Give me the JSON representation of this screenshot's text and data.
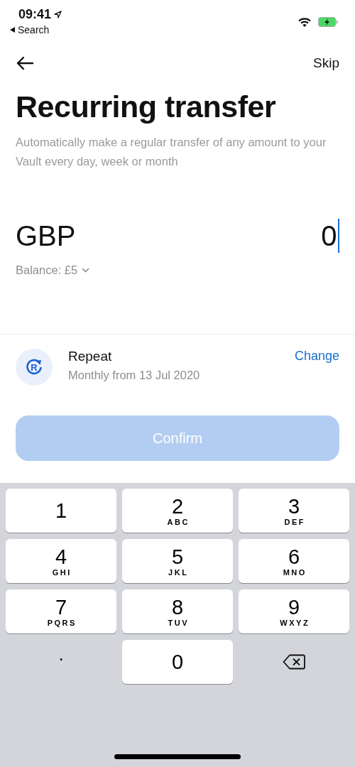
{
  "status_bar": {
    "time": "09:41",
    "back_app": "Search"
  },
  "nav": {
    "skip": "Skip"
  },
  "title": "Recurring transfer",
  "subtitle": "Automatically make a regular transfer of any amount to your Vault every day, week or month",
  "amount": {
    "currency": "GBP",
    "value": "0",
    "focused": true,
    "balance": "Balance: £5"
  },
  "repeat": {
    "icon_letter": "R",
    "label": "Repeat",
    "detail": "Monthly from 13 Jul 2020",
    "action": "Change"
  },
  "confirm": {
    "label": "Confirm",
    "disabled": true
  },
  "keypad": [
    {
      "kind": "digit",
      "digit": "1"
    },
    {
      "kind": "digit",
      "digit": "2",
      "letters": "ABC"
    },
    {
      "kind": "digit",
      "digit": "3",
      "letters": "DEF"
    },
    {
      "kind": "digit",
      "digit": "4",
      "letters": "GHI"
    },
    {
      "kind": "digit",
      "digit": "5",
      "letters": "JKL"
    },
    {
      "kind": "digit",
      "digit": "6",
      "letters": "MNO"
    },
    {
      "kind": "digit",
      "digit": "7",
      "letters": "PQRS"
    },
    {
      "kind": "digit",
      "digit": "8",
      "letters": "TUV"
    },
    {
      "kind": "digit",
      "digit": "9",
      "letters": "WXYZ"
    },
    {
      "kind": "plain",
      "digit": "."
    },
    {
      "kind": "digit",
      "digit": "0"
    },
    {
      "kind": "delete"
    }
  ]
}
